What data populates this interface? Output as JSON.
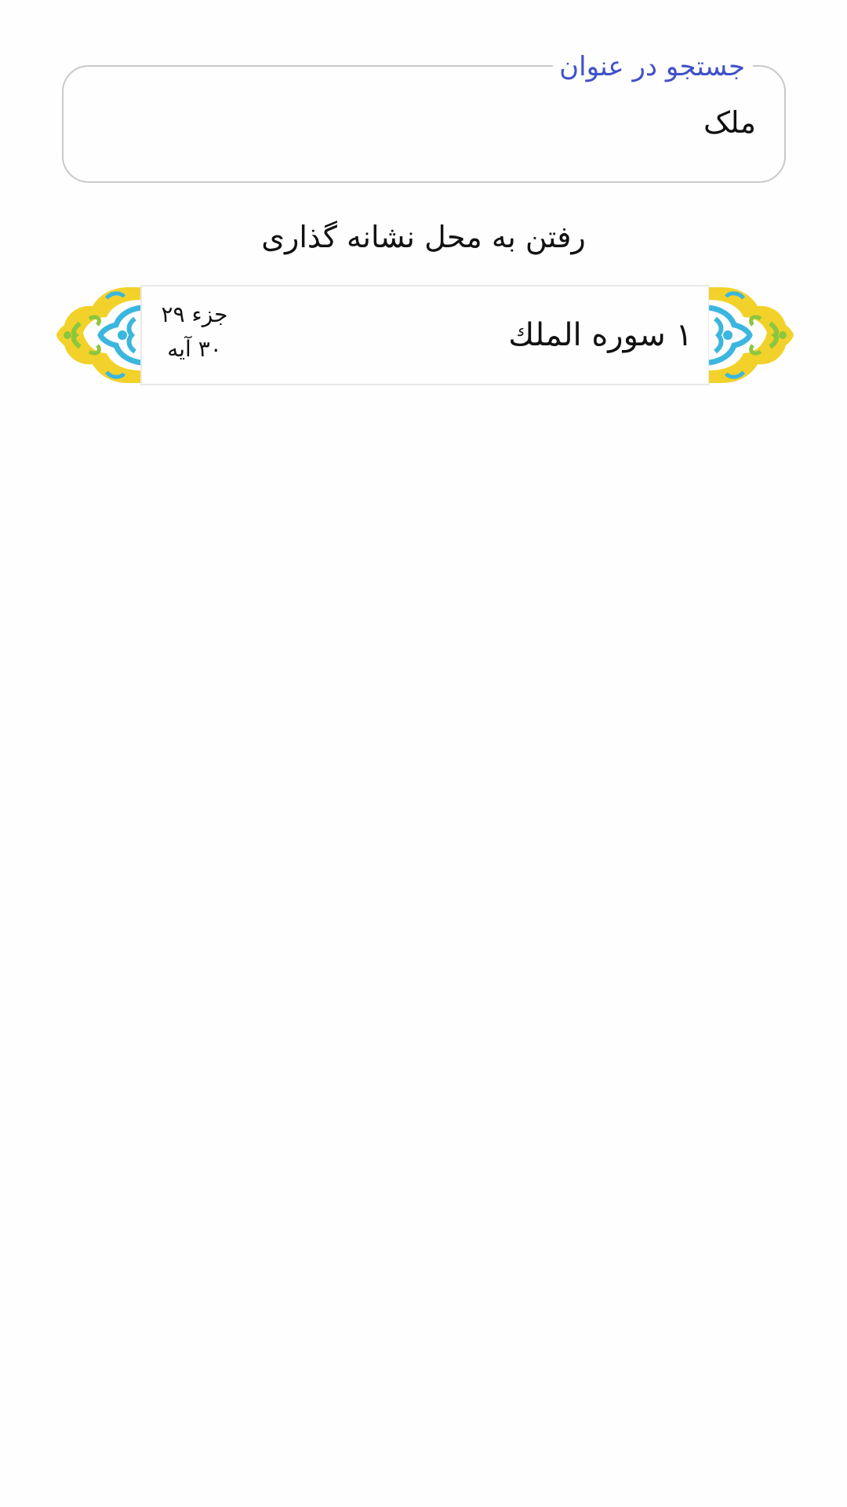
{
  "search": {
    "label": "جستجو در عنوان",
    "value": "ملک"
  },
  "goto_bookmark": "رفتن به محل نشانه گذاری",
  "results": [
    {
      "title": "۱ سوره الملك",
      "juz": "جزء ۲۹",
      "ayat": "۳۰ آیه"
    }
  ],
  "colors": {
    "label_accent": "#3f51c8",
    "ornament_yellow": "#f2d22a",
    "ornament_blue": "#3bb6de",
    "ornament_green": "#8cc63f"
  },
  "icons": {
    "ornament_left": "ornament-icon",
    "ornament_right": "ornament-icon"
  }
}
